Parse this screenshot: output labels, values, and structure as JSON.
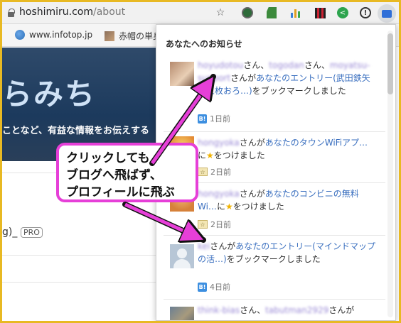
{
  "toolbar": {
    "url_domain": "hoshimiru.com",
    "url_path": "/about"
  },
  "bookmarks": [
    {
      "label": "www.infotop.jp"
    },
    {
      "label": "赤帽の単身"
    }
  ],
  "page": {
    "hero_title": "らみち",
    "hero_sub": "ことなど、有益な情報をお伝えする",
    "text_fragment": "g)_",
    "pro_badge": "PRO"
  },
  "panel": {
    "title": "あなたへのお知らせ",
    "notifications": [
      {
        "user1": "hoyudotou",
        "mid1": "さん、",
        "user2": "togodan",
        "mid2": "さん、",
        "user3": "moyatsu-support",
        "mid3": "さんが",
        "link": "あなたのエントリー(武田鉄矢「三枚おろ…)",
        "tail": "をブックマークしました",
        "time": "1日前",
        "badge": "B!"
      },
      {
        "user1": "hongyoka",
        "mid1": "さんが",
        "link": "あなたのタウンWiFiアプ…",
        "tail": "に",
        "tail2": "をつけました",
        "time": "2日前"
      },
      {
        "user1": "hongyoka",
        "mid1": "さんが",
        "link": "あなたのコンビニの無料Wi…",
        "tail": "に",
        "tail2": "をつけました",
        "time": "2日前"
      },
      {
        "user1": "kei",
        "mid1": "さんが",
        "link": "あなたのエントリー(マインドマップの活…)",
        "tail": "をブックマークしました",
        "time": "4日前",
        "badge": "B!"
      },
      {
        "user1": "think-bias",
        "mid1": "さん、",
        "user2": "tabutman2929",
        "mid2": "さんが"
      }
    ]
  },
  "callout": {
    "line1": "クリックしても",
    "line2": "ブログへ飛ばず、",
    "line3": "プロフィールに飛ぶ"
  }
}
